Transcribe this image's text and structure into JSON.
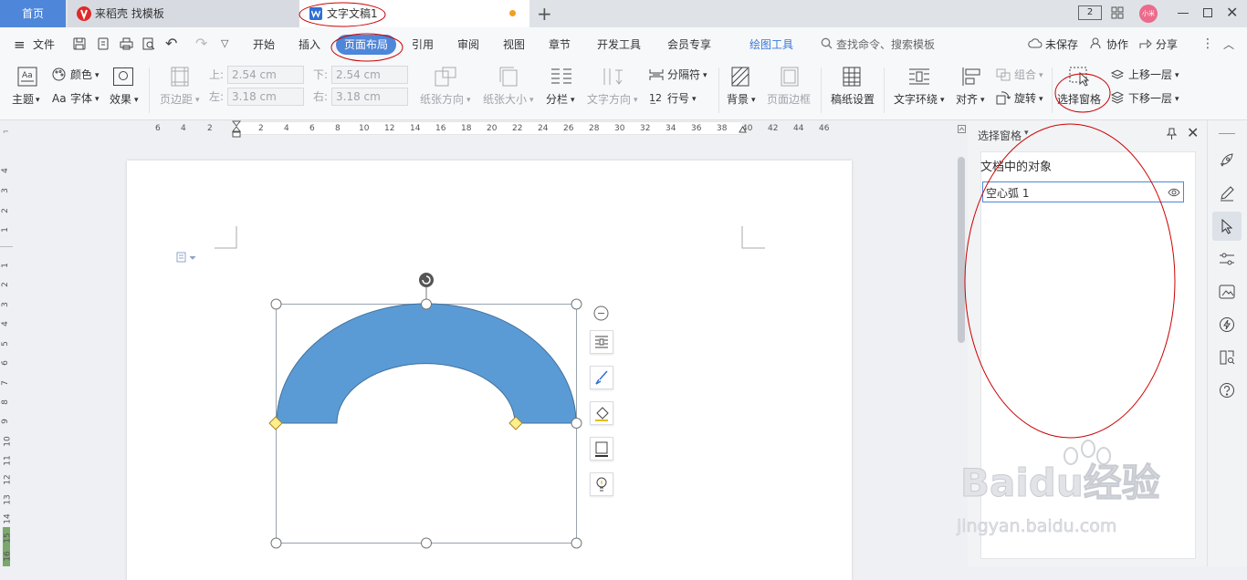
{
  "titlebar": {
    "home_tab": "首页",
    "docer_tab": "来稻壳 找模板",
    "doc_tab": "文字文稿1",
    "window_count": "2",
    "avatar_text": "小米"
  },
  "menubar": {
    "file": "文件",
    "tabs": [
      "开始",
      "插入",
      "页面布局",
      "引用",
      "审阅",
      "视图",
      "章节",
      "开发工具",
      "会员专享",
      "绘图工具"
    ],
    "search": "查找命令、搜索模板",
    "unsaved": "未保存",
    "collab": "协作",
    "share": "分享"
  },
  "ribbon": {
    "theme": "主题",
    "color": "颜色",
    "font": "字体",
    "effect": "效果",
    "margin": "页边距",
    "top_label": "上:",
    "top_value": "2.54 cm",
    "bottom_label": "下:",
    "bottom_value": "2.54 cm",
    "left_label": "左:",
    "left_value": "3.18 cm",
    "right_label": "右:",
    "right_value": "3.18 cm",
    "orientation": "纸张方向",
    "paper_size": "纸张大小",
    "columns": "分栏",
    "text_direction": "文字方向",
    "separator": "分隔符",
    "line_number": "行号",
    "background": "背景",
    "page_border": "页面边框",
    "draft_settings": "稿纸设置",
    "text_wrap": "文字环绕",
    "align": "对齐",
    "group": "组合",
    "rotate": "旋转",
    "selection_pane": "选择窗格",
    "bring_forward": "上移一层",
    "send_backward": "下移一层"
  },
  "ruler": {
    "h_ticks": [
      "6",
      "4",
      "2",
      "2",
      "4",
      "6",
      "8",
      "10",
      "12",
      "14",
      "16",
      "18",
      "20",
      "22",
      "24",
      "26",
      "28",
      "30",
      "32",
      "34",
      "36",
      "38",
      "40",
      "42",
      "44",
      "46"
    ],
    "v_ticks": [
      "4",
      "3",
      "2",
      "1",
      "1",
      "2",
      "3",
      "4",
      "5",
      "6",
      "7",
      "8",
      "9",
      "10",
      "11",
      "12",
      "13",
      "14",
      "15",
      "16"
    ]
  },
  "panel": {
    "title": "选择窗格",
    "section": "文档中的对象",
    "objects": [
      "空心弧 1"
    ]
  },
  "watermark": {
    "brand": "Baidu经验",
    "url": "jingyan.baidu.com"
  },
  "colors": {
    "accent": "#4e86d9",
    "shape_fill": "#5b9bd5",
    "shape_stroke": "#41719c",
    "annotation": "#cc0000"
  }
}
